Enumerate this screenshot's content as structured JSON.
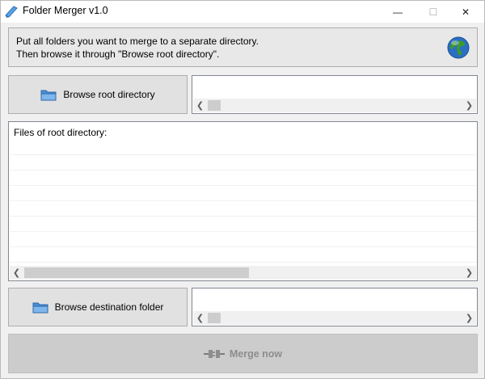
{
  "window": {
    "title": "Folder Merger v1.0",
    "minimize_glyph": "—",
    "maximize_glyph": "☐",
    "close_glyph": "✕"
  },
  "info": {
    "line1": "Put all folders you want to merge to a separate directory.",
    "line2": "Then browse it through \"Browse root directory\"."
  },
  "browse_root": {
    "label": "Browse root directory",
    "path_value": ""
  },
  "files_list": {
    "header": "Files of root directory:",
    "items": []
  },
  "browse_destination": {
    "label": "Browse destination folder",
    "path_value": ""
  },
  "merge": {
    "label": "Merge now",
    "enabled": false
  },
  "icons": {
    "app": "folder-merger-app-icon",
    "info": "globe-icon",
    "browse": "folder-icon",
    "merge": "plug-icon"
  },
  "colors": {
    "accent_folder": "#4a8fd8",
    "globe_green": "#3c9a2a",
    "globe_blue": "#2b6fc2",
    "disabled_text": "#8d8d8d"
  }
}
